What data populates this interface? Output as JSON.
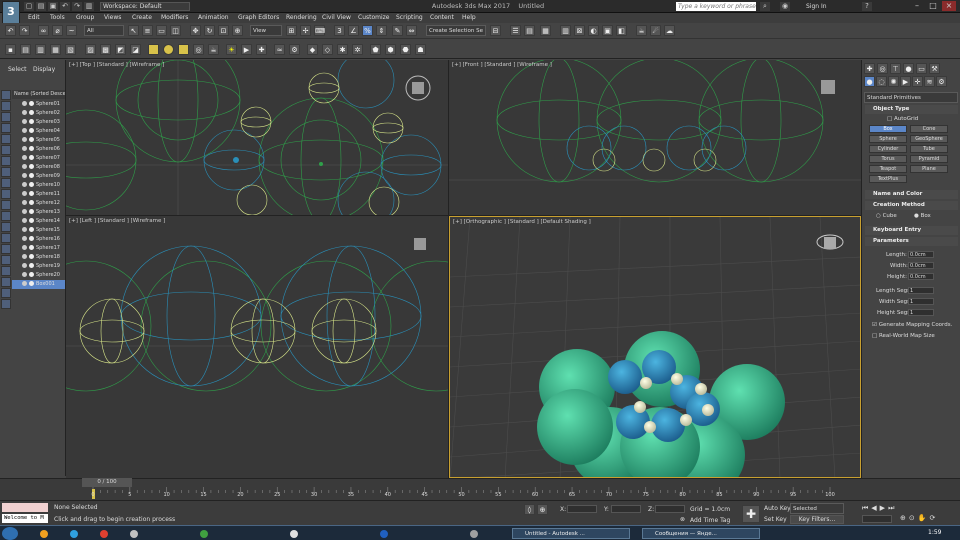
{
  "window": {
    "title": "Autodesk 3ds Max 2017",
    "doc": "Untitled",
    "workspace": "Workspace: Default",
    "search_placeholder": "Type a keyword or phrase",
    "sign_in": "Sign In"
  },
  "menu": [
    "Edit",
    "Tools",
    "Group",
    "Views",
    "Create",
    "Modifiers",
    "Animation",
    "Graph Editors",
    "Rendering",
    "Civil View",
    "Customize",
    "Scripting",
    "Content",
    "Help"
  ],
  "toolbar": {
    "filter": "All",
    "view": "View",
    "selection_set": "Create Selection Se"
  },
  "scene_explorer": {
    "tabs": [
      "Select",
      "Display"
    ],
    "header": "Name (Sorted Descer",
    "items": [
      "Sphere01",
      "Sphere02",
      "Sphere03",
      "Sphere04",
      "Sphere05",
      "Sphere06",
      "Sphere07",
      "Sphere08",
      "Sphere09",
      "Sphere10",
      "Sphere11",
      "Sphere12",
      "Sphere13",
      "Sphere14",
      "Sphere15",
      "Sphere16",
      "Sphere17",
      "Sphere18",
      "Sphere19",
      "Sphere20",
      "Box001"
    ]
  },
  "viewports": [
    {
      "label": "[+] [Top ] [Standard ] [Wireframe ]"
    },
    {
      "label": "[+] [Front ] [Standard ] [Wireframe ]"
    },
    {
      "label": "[+] [Left ] [Standard ] [Wireframe ]"
    },
    {
      "label": "[+] [Orthographic ] [Standard ] [Default Shading ]"
    }
  ],
  "command_panel": {
    "dropdown": "Standard Primitives",
    "object_type": "Object Type",
    "autogrid": "AutoGrid",
    "buttons": [
      "Box",
      "Cone",
      "Sphere",
      "GeoSphere",
      "Cylinder",
      "Tube",
      "Torus",
      "Pyramid",
      "Teapot",
      "Plane",
      "TextPlus"
    ],
    "name_color": "Name and Color",
    "creation_method": "Creation Method",
    "cube": "Cube",
    "box": "Box",
    "keyboard_entry": "Keyboard Entry",
    "parameters": "Parameters",
    "length_label": "Length:",
    "length": "0.0cm",
    "width_label": "Width:",
    "width": "0.0cm",
    "height_label": "Height:",
    "height": "0.0cm",
    "length_segs_label": "Length Segs:",
    "length_segs": "1",
    "width_segs_label": "Width Segs:",
    "width_segs": "1",
    "height_segs_label": "Height Segs:",
    "height_segs": "1",
    "gen_mapping": "Generate Mapping Coords.",
    "real_world": "Real-World Map Size"
  },
  "timeline": {
    "frame": "0 / 100",
    "ticks": [
      "0",
      "5",
      "10",
      "15",
      "20",
      "25",
      "30",
      "35",
      "40",
      "45",
      "50",
      "55",
      "60",
      "65",
      "70",
      "75",
      "80",
      "85",
      "90",
      "95",
      "100"
    ]
  },
  "status": {
    "listener": "Welcome to M",
    "selected": "None Selected",
    "prompt": "Click and drag to begin creation process",
    "x": "X:",
    "y": "Y:",
    "z": "Z:",
    "grid": "Grid = 1.0cm",
    "add_time_tag": "Add Time Tag",
    "auto_key": "Auto Key",
    "set_key": "Set Key",
    "selected_dd": "Selected",
    "key_filters": "Key Filters..."
  },
  "taskbar": {
    "tasks": [
      "Untitled - Autodesk ...",
      "Сообщения — Янде..."
    ],
    "time": "1:59"
  }
}
